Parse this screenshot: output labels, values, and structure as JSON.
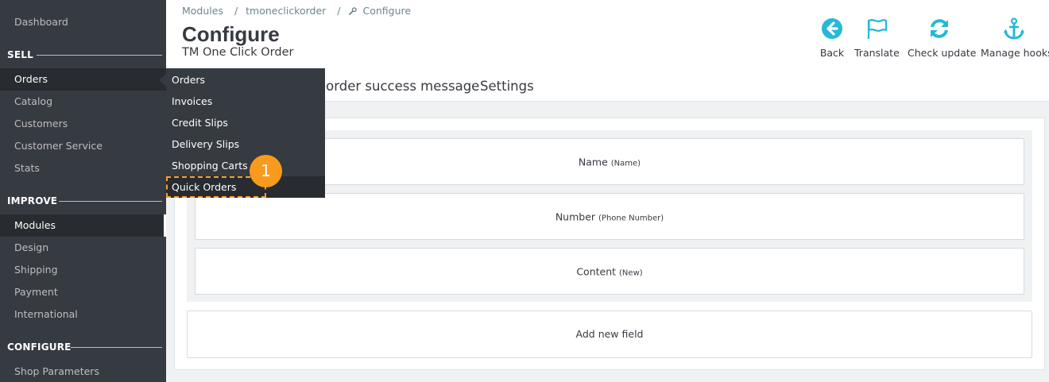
{
  "sidebar": {
    "dashboard": "Dashboard",
    "sections": {
      "sell": "SELL",
      "improve": "IMPROVE",
      "configure": "CONFIGURE"
    },
    "sell_items": [
      "Orders",
      "Catalog",
      "Customers",
      "Customer Service",
      "Stats"
    ],
    "improve_items": [
      "Modules",
      "Design",
      "Shipping",
      "Payment",
      "International"
    ],
    "configure_items": [
      "Shop Parameters"
    ]
  },
  "submenu": {
    "items": [
      "Orders",
      "Invoices",
      "Credit Slips",
      "Delivery Slips",
      "Shopping Carts",
      "Quick Orders"
    ],
    "highlighted": "Quick Orders",
    "callout_number": "1"
  },
  "breadcrumb": {
    "items": [
      "Modules",
      "/",
      "tmoneclickorder",
      "/",
      "Configure"
    ],
    "wrench_icon": "wrench-icon"
  },
  "header": {
    "title": "Configure",
    "subtitle": "TM One Click Order",
    "tabs": [
      "eorder success message",
      "Settings"
    ]
  },
  "toolbar": {
    "back": "Back",
    "translate": "Translate",
    "check_update": "Check update",
    "manage_hooks": "Manage hooks",
    "accent_color": "#25b9d7"
  },
  "fields": [
    {
      "label": "Name",
      "sub": "(Name)"
    },
    {
      "label": "Number",
      "sub": "(Phone Number)"
    },
    {
      "label": "Content",
      "sub": "(New)"
    }
  ],
  "add_field_label": "Add new field",
  "colors": {
    "sidebar_bg": "#363a41",
    "sidebar_active": "#282b30",
    "callout": "#f89b1c"
  }
}
